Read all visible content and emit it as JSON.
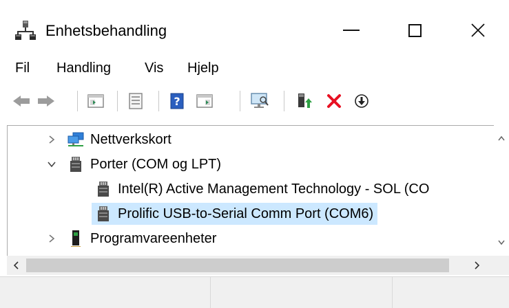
{
  "window": {
    "title": "Enhetsbehandling",
    "icon": "device-manager-icon",
    "controls": [
      "minimize-icon",
      "maximize-icon",
      "close-icon"
    ]
  },
  "menu": {
    "items": [
      {
        "label": "Fil"
      },
      {
        "label": "Handling"
      },
      {
        "label": "Vis"
      },
      {
        "label": "Hjelp"
      }
    ]
  },
  "toolbar": {
    "buttons": [
      "back-arrow-icon",
      "forward-arrow-icon",
      "properties-pane-icon",
      "properties-icon",
      "help-icon",
      "action-pane-icon",
      "scan-hardware-icon",
      "update-driver-icon",
      "uninstall-icon",
      "disable-device-icon"
    ]
  },
  "tree": {
    "rows": [
      {
        "label": "Nettverkskort",
        "expanded": false,
        "icon": "network-adapter-icon",
        "selected": false
      },
      {
        "label": "Porter (COM og LPT)",
        "expanded": true,
        "icon": "port-icon",
        "selected": false
      },
      {
        "label": "Intel(R) Active Management Technology - SOL (CO",
        "icon": "port-icon",
        "selected": false
      },
      {
        "label": "Prolific USB-to-Serial Comm Port (COM6)",
        "icon": "port-icon",
        "selected": true
      },
      {
        "label": "Programvareenheter",
        "expanded": false,
        "icon": "software-device-icon",
        "selected": false
      }
    ]
  },
  "colors": {
    "selection": "#cce8ff",
    "uninstall_red": "#e81123",
    "help_blue": "#2b5fbf"
  }
}
